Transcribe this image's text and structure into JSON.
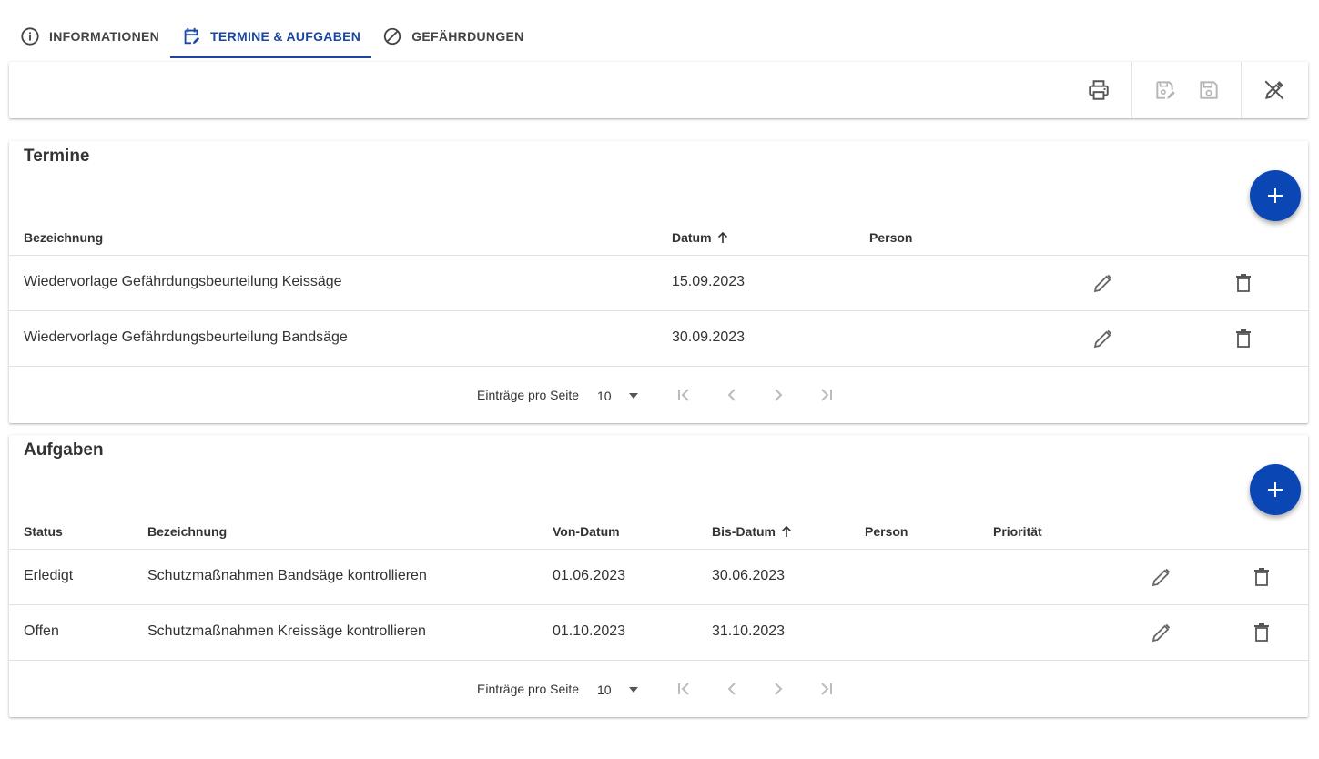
{
  "tabs": [
    {
      "label": "INFORMATIONEN",
      "icon": "info-icon"
    },
    {
      "label": "TERMINE & AUFGABEN",
      "icon": "calendar-edit-icon",
      "active": true
    },
    {
      "label": "GEFÄHRDUNGEN",
      "icon": "block-icon"
    }
  ],
  "toolbar": {
    "icons": [
      "print-icon",
      "save-edit-icon",
      "save-icon",
      "edit-off-icon"
    ]
  },
  "colors": {
    "accent": "#0a47b4",
    "tab_active": "#1a47a3",
    "icon": "#555555",
    "icon_disabled": "#b5b5b5"
  },
  "termine": {
    "title": "Termine",
    "headers": {
      "bezeichnung": "Bezeichnung",
      "datum": "Datum",
      "person": "Person"
    },
    "rows": [
      {
        "bezeichnung": "Wiedervorlage Gefährdungsbeurteilung Keissäge",
        "datum": "15.09.2023",
        "person": ""
      },
      {
        "bezeichnung": "Wiedervorlage Gefährdungsbeurteilung Bandsäge",
        "datum": "30.09.2023",
        "person": ""
      }
    ],
    "pager": {
      "label": "Einträge pro Seite",
      "page_size": "10"
    }
  },
  "aufgaben": {
    "title": "Aufgaben",
    "headers": {
      "status": "Status",
      "bezeichnung": "Bezeichnung",
      "von": "Von-Datum",
      "bis": "Bis-Datum",
      "person": "Person",
      "prioritaet": "Priorität"
    },
    "rows": [
      {
        "status": "Erledigt",
        "bezeichnung": "Schutzmaßnahmen Bandsäge kontrollieren",
        "von": "01.06.2023",
        "bis": "30.06.2023",
        "person": "",
        "prioritaet": ""
      },
      {
        "status": "Offen",
        "bezeichnung": "Schutzmaßnahmen Kreissäge kontrollieren",
        "von": "01.10.2023",
        "bis": "31.10.2023",
        "person": "",
        "prioritaet": ""
      }
    ],
    "pager": {
      "label": "Einträge pro Seite",
      "page_size": "10"
    }
  }
}
